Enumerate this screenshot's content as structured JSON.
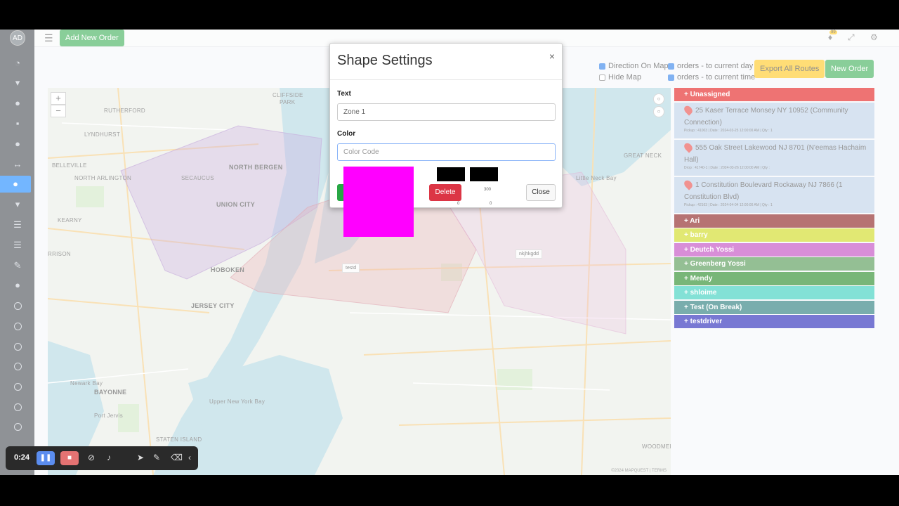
{
  "sidebar": {
    "avatar": "AD"
  },
  "topbar": {
    "add_order": "Add New Order",
    "notif_count": "99"
  },
  "controls": {
    "direction_on_map": "Direction On Map",
    "hide_map": "Hide Map",
    "orders_current_day": "orders - to current day",
    "orders_current_time": "orders - to current time",
    "export_routes": "Export All Routes",
    "new_order": "New Order"
  },
  "map": {
    "zoom_in": "+",
    "zoom_out": "−",
    "labels": {
      "rutherford": "RUTHERFORD",
      "lyndhurst": "LYNDHURST",
      "cliffside": "CLIFFSIDE",
      "park": "PARK",
      "belleville": "BELLEVILLE",
      "north_arlington": "NORTH ARLINGTON",
      "secaucus": "SECAUCUS",
      "north_bergen": "NORTH BERGEN",
      "union_city": "UNION CITY",
      "kearny": "KEARNY",
      "harrison": "RRISON",
      "hoboken": "HOBOKEN",
      "jersey_city": "JERSEY CITY",
      "great_neck": "GREAT NECK",
      "little_neck_bay": "Little Neck Bay",
      "bayonne": "BAYONNE",
      "upper_bay": "Upper New York Bay",
      "staten_island": "STATEN ISLAND",
      "woodmere": "WOODMERE",
      "newark_bay": "Newark Bay",
      "port_jervis": "Port Jervis"
    },
    "shape_tags": {
      "testd": "testd",
      "nkjhkgdd": "nkjhkgdd"
    },
    "credit": "©2024 MAPQUEST  |  TERMS"
  },
  "orders": {
    "unassigned_label": "+ Unassigned",
    "items": [
      {
        "address": "25 Kaser Terrace Monsey NY 10952 (Community Connection)",
        "meta": "Pickup : 41003 | Date : 2024-03-25 12:00:00 AM | Qty : 1"
      },
      {
        "address": "555 Oak Street Lakewood NJ 8701 (N'eemas Hachaim Hall)",
        "meta": "Drop : 41740-1 | Date : 2024-03-26 12:00:00 AM | Qty :"
      },
      {
        "address": "1 Constitution Boulevard Rockaway NJ 7866 (1 Constitution Blvd)",
        "meta": "Pickup : 42163 | Date : 2024-04-04 12:00:00 AM | Qty : 1"
      }
    ],
    "drivers": [
      {
        "name": "+ Ari",
        "color": "#7b0000"
      },
      {
        "name": "+ barry",
        "color": "#c9d600"
      },
      {
        "name": "+ Deutch Yossi",
        "color": "#b832b8"
      },
      {
        "name": "+ Greenberg Yossi",
        "color": "#3d8a3d"
      },
      {
        "name": "+ Mendy",
        "color": "#0a7a0a"
      },
      {
        "name": "+ shloime",
        "color": "#1ec8b4"
      },
      {
        "name": "+ Test (On Break)",
        "color": "#0b6b6b"
      },
      {
        "name": "+ testdriver",
        "color": "#0a0ab0"
      }
    ],
    "unassigned_color": "#e00000"
  },
  "modal": {
    "title": "Shape Settings",
    "close_x": "×",
    "text_label": "Text",
    "text_value": "Zone 1",
    "color_label": "Color",
    "color_placeholder": "Color Code",
    "swatch_color": "#ff00ff",
    "delete": "Delete",
    "close": "Close",
    "num_300": "300",
    "num_0a": "0",
    "num_0b": "0"
  },
  "recorder": {
    "time": "0:24"
  }
}
